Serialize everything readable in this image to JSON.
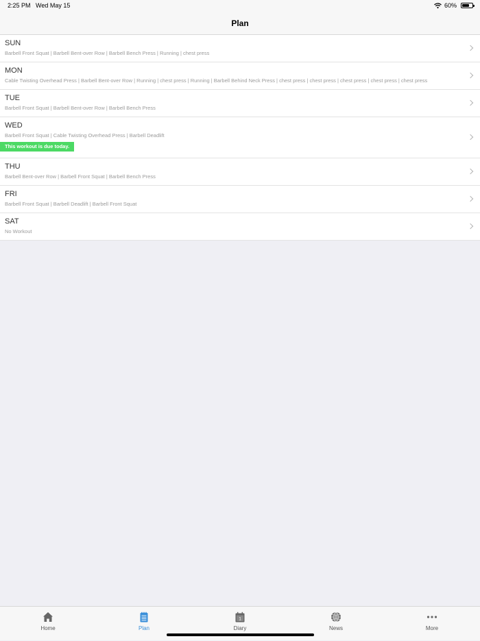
{
  "status_bar": {
    "time": "2:25 PM",
    "date": "Wed May 15",
    "battery_text": "60%",
    "battery_level": 0.6
  },
  "nav": {
    "title": "Plan"
  },
  "days": [
    {
      "day": "SUN",
      "exercises": "Barbell Front Squat | Barbell Bent-over Row | Barbell Bench Press | Running | chest press"
    },
    {
      "day": "MON",
      "exercises": "Cable Twisting Overhead Press | Barbell Bent-over Row | Running | chest press | Running | Barbell Behind Neck Press | chest press | chest press | chest press | chest press | chest press"
    },
    {
      "day": "TUE",
      "exercises": "Barbell Front Squat | Barbell Bent-over Row | Barbell Bench Press"
    },
    {
      "day": "WED",
      "exercises": "Barbell Front Squat | Cable Twisting Overhead Press | Barbell Deadlift",
      "badge": "This workout is due today."
    },
    {
      "day": "THU",
      "exercises": "Barbell Bent-over Row | Barbell Front Squat | Barbell Bench Press"
    },
    {
      "day": "FRI",
      "exercises": "Barbell Front Squat | Barbell Deadlift | Barbell Front Squat"
    },
    {
      "day": "SAT",
      "exercises": "No Workout"
    }
  ],
  "tabs": [
    {
      "label": "Home",
      "icon": "home-icon"
    },
    {
      "label": "Plan",
      "icon": "notepad-icon",
      "active": true
    },
    {
      "label": "Diary",
      "icon": "calendar-icon"
    },
    {
      "label": "News",
      "icon": "globe-icon"
    },
    {
      "label": "More",
      "icon": "more-icon"
    }
  ],
  "colors": {
    "accent": "#3a8fd9",
    "badge": "#4cd964",
    "tab_icon": "#666666"
  }
}
